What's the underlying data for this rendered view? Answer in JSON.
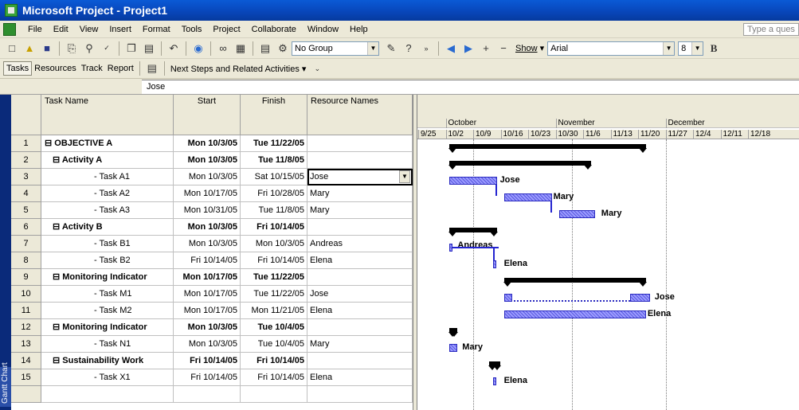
{
  "window": {
    "title": "Microsoft Project - Project1"
  },
  "menu": {
    "items": [
      "File",
      "Edit",
      "View",
      "Insert",
      "Format",
      "Tools",
      "Project",
      "Collaborate",
      "Window",
      "Help"
    ],
    "help_placeholder": "Type a ques"
  },
  "toolbar": {
    "group_value": "No Group",
    "show_label": "Show",
    "font_value": "Arial",
    "size_value": "8",
    "bold_label": "B"
  },
  "guide": {
    "tasks": "Tasks",
    "resources": "Resources",
    "track": "Track",
    "report": "Report",
    "next_steps": "Next Steps and Related Activities"
  },
  "entry_bar": {
    "value": "Jose"
  },
  "view_bar": {
    "label": "Gantt Chart"
  },
  "table": {
    "headers": [
      "Task Name",
      "Start",
      "Finish",
      "Resource Names"
    ],
    "rows": [
      {
        "id": "1",
        "name": "⊟ OBJECTIVE A",
        "start": "Mon 10/3/05",
        "finish": "Tue 11/22/05",
        "resource": ""
      },
      {
        "id": "2",
        "name": "⊟ Activity A",
        "start": "Mon 10/3/05",
        "finish": "Tue 11/8/05",
        "resource": ""
      },
      {
        "id": "3",
        "name": "- Task A1",
        "start": "Mon 10/3/05",
        "finish": "Sat 10/15/05",
        "resource": "Jose"
      },
      {
        "id": "4",
        "name": "- Task A2",
        "start": "Mon 10/17/05",
        "finish": "Fri 10/28/05",
        "resource": "Mary"
      },
      {
        "id": "5",
        "name": "- Task A3",
        "start": "Mon 10/31/05",
        "finish": "Tue 11/8/05",
        "resource": "Mary"
      },
      {
        "id": "6",
        "name": "⊟ Activity B",
        "start": "Mon 10/3/05",
        "finish": "Fri 10/14/05",
        "resource": ""
      },
      {
        "id": "7",
        "name": "- Task B1",
        "start": "Mon 10/3/05",
        "finish": "Mon 10/3/05",
        "resource": "Andreas"
      },
      {
        "id": "8",
        "name": "- Task B2",
        "start": "Fri 10/14/05",
        "finish": "Fri 10/14/05",
        "resource": "Elena"
      },
      {
        "id": "9",
        "name": "⊟ Monitoring Indicator",
        "start": "Mon 10/17/05",
        "finish": "Tue 11/22/05",
        "resource": ""
      },
      {
        "id": "10",
        "name": "- Task M1",
        "start": "Mon 10/17/05",
        "finish": "Tue 11/22/05",
        "resource": "Jose"
      },
      {
        "id": "11",
        "name": "- Task M2",
        "start": "Mon 10/17/05",
        "finish": "Mon 11/21/05",
        "resource": "Elena"
      },
      {
        "id": "12",
        "name": "⊟ Monitoring Indicator",
        "start": "Mon 10/3/05",
        "finish": "Tue 10/4/05",
        "resource": ""
      },
      {
        "id": "13",
        "name": "- Task N1",
        "start": "Mon 10/3/05",
        "finish": "Tue 10/4/05",
        "resource": "Mary"
      },
      {
        "id": "14",
        "name": "⊟ Sustainability Work",
        "start": "Fri 10/14/05",
        "finish": "Fri 10/14/05",
        "resource": ""
      },
      {
        "id": "15",
        "name": "- Task X1",
        "start": "Fri 10/14/05",
        "finish": "Fri 10/14/05",
        "resource": "Elena"
      }
    ]
  },
  "timescale": {
    "months": [
      "October",
      "November",
      "December"
    ],
    "weeks": [
      "9/25",
      "10/2",
      "10/9",
      "10/16",
      "10/23",
      "10/30",
      "11/6",
      "11/13",
      "11/20",
      "11/27",
      "12/4",
      "12/11",
      "12/18"
    ]
  },
  "gantt_labels": {
    "r3": "Jose",
    "r4": "Mary",
    "r5": "Mary",
    "r7": "Andreas",
    "r8": "Elena",
    "r10": "Jose",
    "r11": "Elena",
    "r13": "Mary",
    "r15": "Elena"
  },
  "colors": {
    "title_bar": "#0845b8",
    "task_bar": "#7d7dff",
    "summary_bar": "#000000"
  }
}
